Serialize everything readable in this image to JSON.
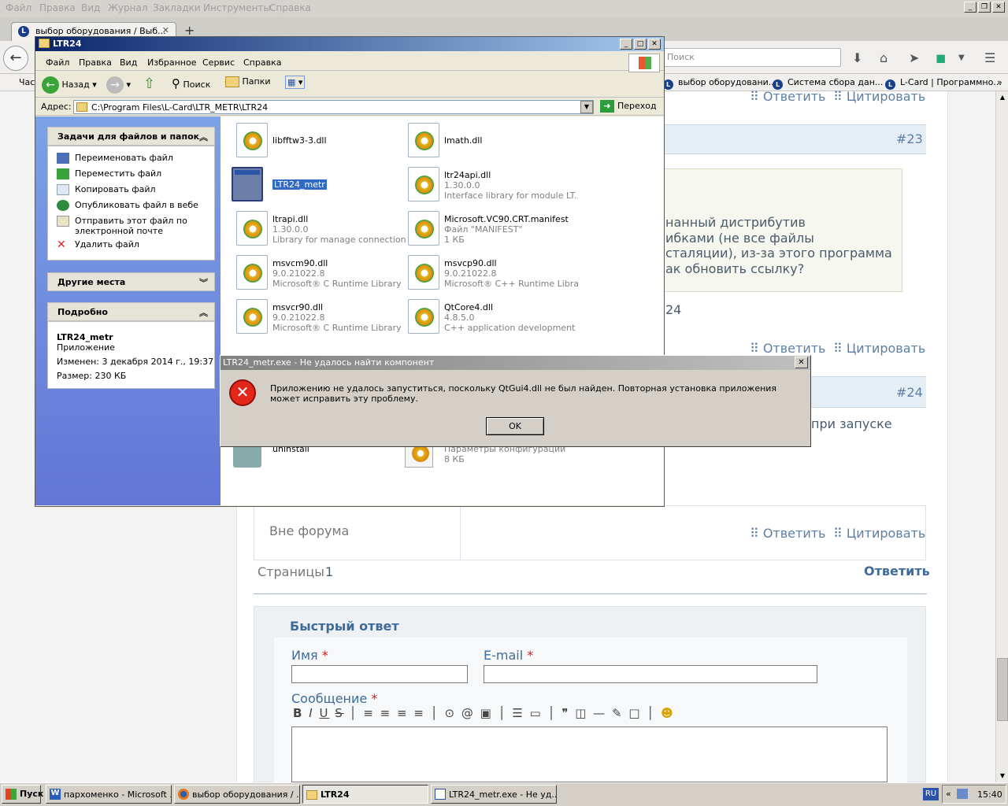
{
  "firefox": {
    "menu": [
      "Файл",
      "Правка",
      "Вид",
      "Журнал",
      "Закладки",
      "Инструменты",
      "Справка"
    ],
    "tab_title": "выбор оборудования / Выб...",
    "new_tab": "+",
    "search_placeholder": "Поиск",
    "bookmarks": [
      "Час",
      "выбор оборудовани...",
      "Система сбора дан...",
      "L-Card | Программно..."
    ]
  },
  "forum": {
    "reply": "Ответить",
    "quote": "Цитировать",
    "post23": "#23",
    "post24": "#24",
    "quote_lines": [
      "нанный дистрибутив",
      "ибками (не все файлы",
      "сталяции), из-за этого программа",
      "ак обновить ссылку?"
    ],
    "fragment_24": "24",
    "post24_text": "при запуске",
    "offline": "Вне форума",
    "pages_label": "Страницы",
    "pages_num": "1",
    "quick_reply": "Быстрый ответ",
    "name_label": "Имя",
    "email_label": "E-mail",
    "message_label": "Сообщение",
    "required": "*"
  },
  "explorer": {
    "title": "LTR24",
    "menu": [
      "Файл",
      "Правка",
      "Вид",
      "Избранное",
      "Сервис",
      "Справка"
    ],
    "back": "Назад",
    "search": "Поиск",
    "folders": "Папки",
    "address_label": "Адрес:",
    "address": "C:\\Program Files\\L-Card\\LTR_METR\\LTR24",
    "go": "Переход",
    "tasks_header": "Задачи для файлов и папок",
    "tasks": [
      "Переименовать файл",
      "Переместить файл",
      "Копировать файл",
      "Опубликовать файл в вебе",
      "Отправить этот файл по",
      "электронной почте",
      "Удалить файл"
    ],
    "other_places": "Другие места",
    "details_header": "Подробно",
    "details": {
      "name": "LTR24_metr",
      "type": "Приложение",
      "modified": "Изменен: 3 декабря 2014 г., 19:37",
      "size": "Размер: 230 КБ"
    },
    "files": [
      {
        "name": "libfftw3-3.dll",
        "d1": "",
        "d2": ""
      },
      {
        "name": "lmath.dll",
        "d1": "",
        "d2": ""
      },
      {
        "name": "LTR24_metr",
        "d1": "",
        "d2": ""
      },
      {
        "name": "ltr24api.dll",
        "d1": "1.30.0.0",
        "d2": "Interface library for module LT..."
      },
      {
        "name": "ltrapi.dll",
        "d1": "1.30.0.0",
        "d2": "Library for manage connection..."
      },
      {
        "name": "Microsoft.VC90.CRT.manifest",
        "d1": "Файл \"MANIFEST\"",
        "d2": "1 КБ"
      },
      {
        "name": "msvcm90.dll",
        "d1": "9.0.21022.8",
        "d2": "Microsoft® C Runtime Library"
      },
      {
        "name": "msvcp90.dll",
        "d1": "9.0.21022.8",
        "d2": "Microsoft® C++ Runtime Library"
      },
      {
        "name": "msvcr90.dll",
        "d1": "9.0.21022.8",
        "d2": "Microsoft® C Runtime Library"
      },
      {
        "name": "QtCore4.dll",
        "d1": "4.8.5.0",
        "d2": "C++ application development ..."
      },
      {
        "name": "uninstall",
        "d1": "",
        "d2": ""
      },
      {
        "name": "",
        "d1": "Параметры конфигурации",
        "d2": "8 КБ"
      }
    ]
  },
  "dialog": {
    "title": "LTR24_metr.exe - Не удалось найти компонент",
    "message": "Приложению не удалось запуститься, поскольку QtGui4.dll не был найден. Повторная установка приложения может исправить эту проблему.",
    "ok": "OK"
  },
  "taskbar": {
    "start": "Пуск",
    "items": [
      "пархоменко - Microsoft ...",
      "выбор оборудования / ...",
      "LTR24",
      "LTR24_metr.exe - Не уд..."
    ],
    "lang": "RU",
    "time": "15:40"
  }
}
